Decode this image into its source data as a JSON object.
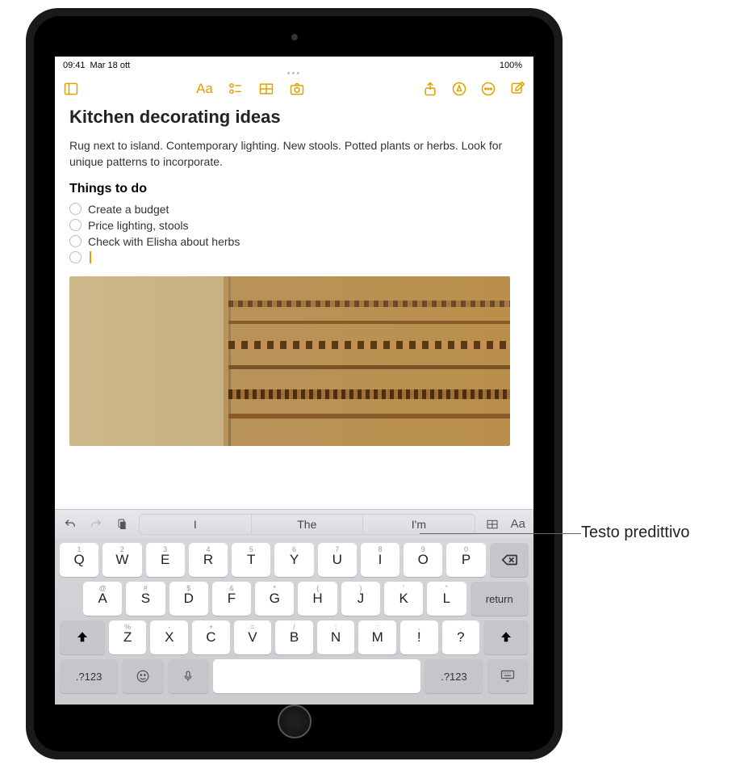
{
  "status": {
    "time": "09:41",
    "date": "Mar 18 ott",
    "battery": "100%"
  },
  "toolbar_icons": {
    "sidebar": "sidebar-icon",
    "format": "Aa",
    "checklist": "checklist-icon",
    "table": "table-icon",
    "camera": "camera-icon",
    "share": "share-icon",
    "markup": "markup-icon",
    "more": "more-icon",
    "compose": "compose-icon"
  },
  "note": {
    "title": "Kitchen decorating ideas",
    "body": "Rug next to island. Contemporary lighting. New stools. Potted plants or herbs. Look for unique patterns to incorporate.",
    "heading": "Things to do",
    "checklist": [
      "Create a budget",
      "Price lighting, stools",
      "Check with Elisha about herbs"
    ]
  },
  "predictive": {
    "s1": "I",
    "s2": "The",
    "s3": "I'm"
  },
  "keys": {
    "row1": [
      "Q",
      "W",
      "E",
      "R",
      "T",
      "Y",
      "U",
      "I",
      "O",
      "P"
    ],
    "row1sub": [
      "1",
      "2",
      "3",
      "4",
      "5",
      "6",
      "7",
      "8",
      "9",
      "0"
    ],
    "row2": [
      "A",
      "S",
      "D",
      "F",
      "G",
      "H",
      "J",
      "K",
      "L"
    ],
    "row2sub": [
      "@",
      "#",
      "$",
      "&",
      "*",
      "(",
      ")",
      "'",
      "\""
    ],
    "row3": [
      "Z",
      "X",
      "C",
      "V",
      "B",
      "N",
      "M"
    ],
    "row3sub": [
      "%",
      "-",
      "+",
      "=",
      "/",
      ";",
      ":"
    ],
    "punct1": "!",
    "punct1sub": ",",
    "punct2": "?",
    "punct2sub": ".",
    "numkey": ".?123",
    "return": "return"
  },
  "kbbar_icons": {
    "table": "Aa"
  },
  "callout": "Testo predittivo"
}
